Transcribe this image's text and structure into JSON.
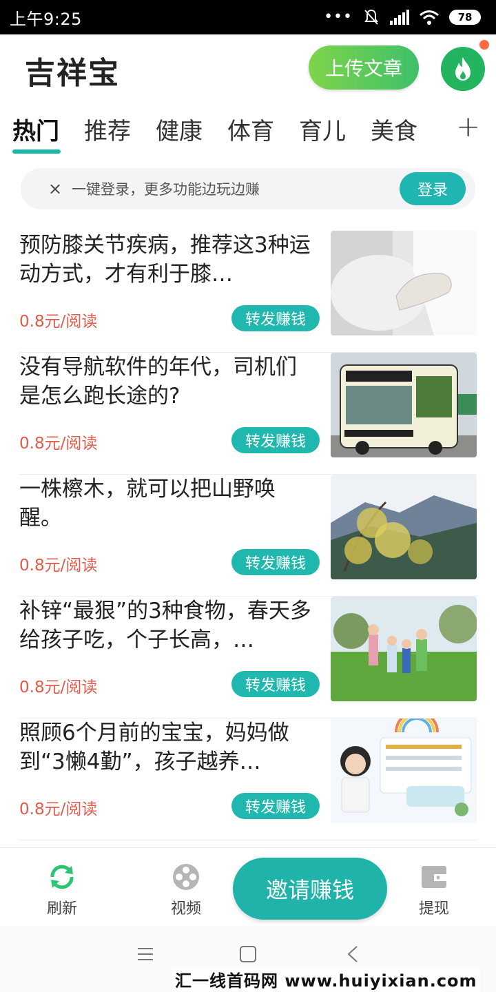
{
  "status_bar": {
    "time": "上午9:25",
    "battery": "78"
  },
  "header": {
    "title": "吉祥宝",
    "upload_label": "上传文章"
  },
  "tabs": [
    {
      "label": "热门",
      "active": true
    },
    {
      "label": "推荐",
      "active": false
    },
    {
      "label": "健康",
      "active": false
    },
    {
      "label": "体育",
      "active": false
    },
    {
      "label": "育儿",
      "active": false
    },
    {
      "label": "美食",
      "active": false
    }
  ],
  "tab_add": "+",
  "login_banner": {
    "close": "×",
    "text": "一键登录，更多功能边玩边赚",
    "button": "登录"
  },
  "articles": [
    {
      "title": "预防膝关节疾病，推荐这3种运动方式，才有利于膝…",
      "price": "0.8元/阅读",
      "share": "转发赚钱",
      "thumb": "knee-photo"
    },
    {
      "title": "没有导航软件的年代，司机们是怎么跑长途的?",
      "price": "0.8元/阅读",
      "share": "转发赚钱",
      "thumb": "bus-photo"
    },
    {
      "title": "一株檫木，就可以把山野唤醒。",
      "price": "0.8元/阅读",
      "share": "转发赚钱",
      "thumb": "mountain-photo"
    },
    {
      "title": "补锌“最狠”的3种食物，春天多给孩子吃，个子长高，…",
      "price": "0.8元/阅读",
      "share": "转发赚钱",
      "thumb": "children-photo"
    },
    {
      "title": "照顾6个月前的宝宝，妈妈做到“3懒4勤”，孩子越养…",
      "price": "0.8元/阅读",
      "share": "转发赚钱",
      "thumb": "parenting-poster"
    }
  ],
  "bottom_nav": {
    "refresh": "刷新",
    "video": "视频",
    "invite": "邀请赚钱",
    "withdraw": "提现"
  },
  "watermark": "汇一线首码网 www.huiyixian.com",
  "colors": {
    "accent": "#1fb3aa",
    "price": "#e25a4a",
    "upload_green": "#5ccb5a"
  }
}
